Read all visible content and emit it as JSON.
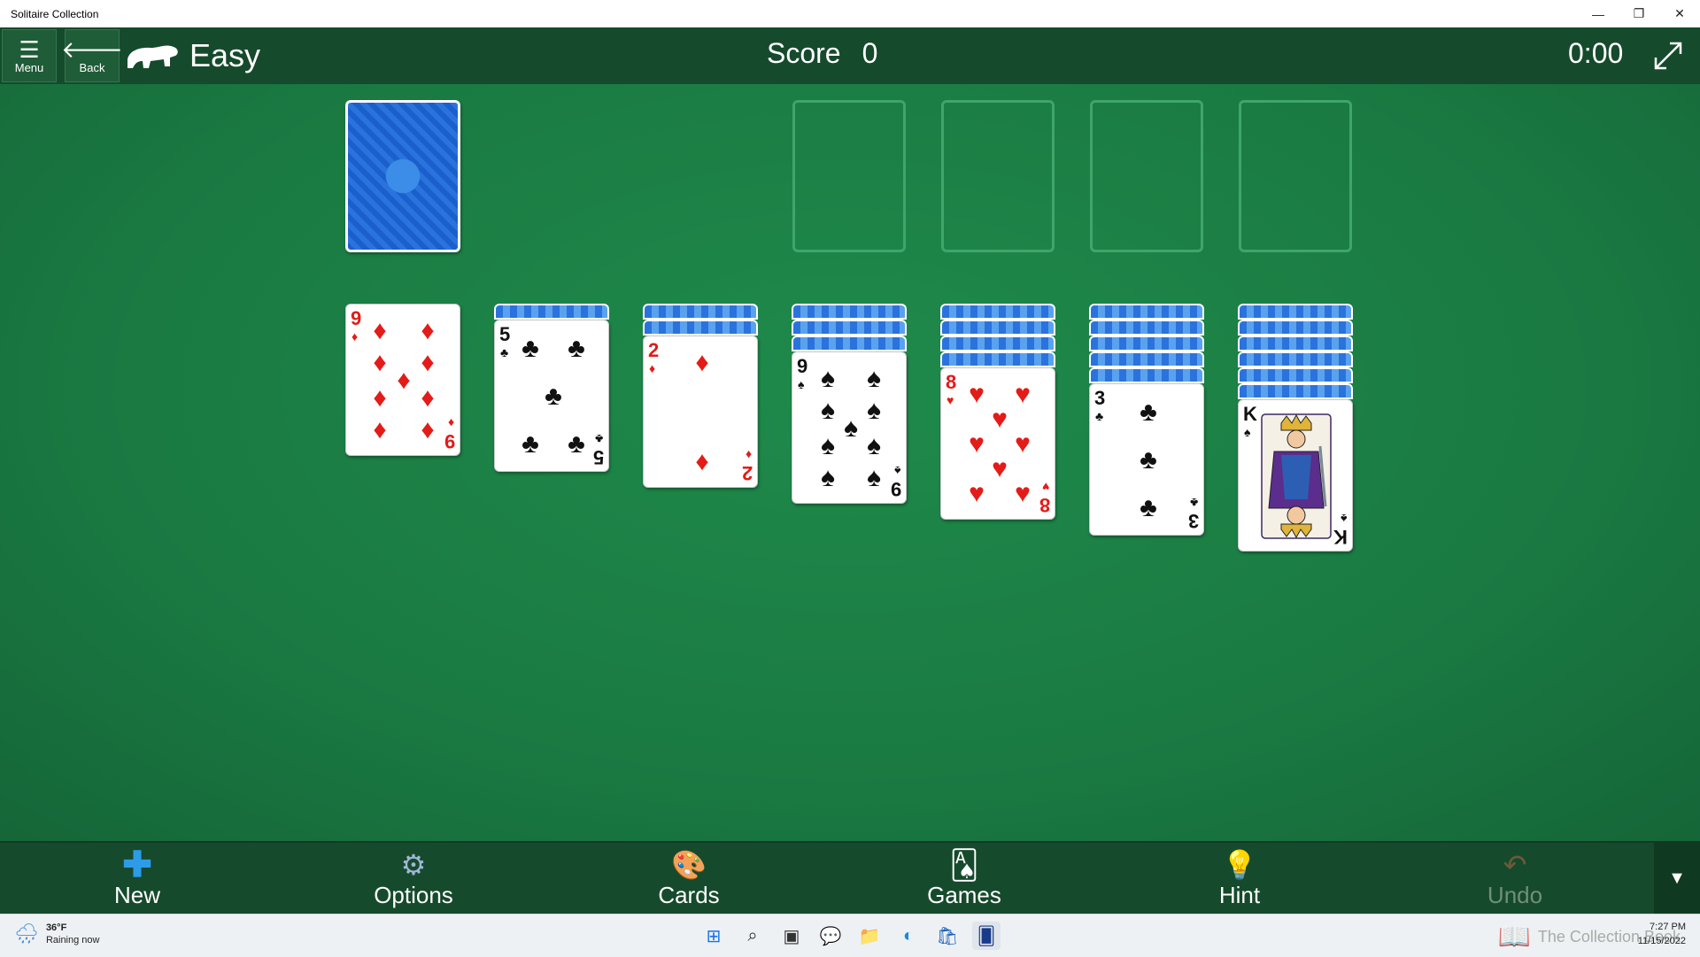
{
  "window": {
    "title": "Solitaire Collection",
    "controls": {
      "minimize": "—",
      "restore": "❐",
      "close": "✕"
    }
  },
  "header": {
    "menu_label": "Menu",
    "back_label": "Back",
    "difficulty": "Easy",
    "score_label": "Score",
    "score_value": "0",
    "timer": "0:00"
  },
  "board": {
    "tableau": [
      {
        "rank": "9",
        "suit": "♦",
        "color": "red"
      },
      {
        "rank": "5",
        "suit": "♣",
        "color": "black"
      },
      {
        "rank": "2",
        "suit": "♦",
        "color": "red"
      },
      {
        "rank": "9",
        "suit": "♠",
        "color": "black"
      },
      {
        "rank": "8",
        "suit": "♥",
        "color": "red"
      },
      {
        "rank": "3",
        "suit": "♣",
        "color": "black"
      },
      {
        "rank": "K",
        "suit": "♠",
        "color": "black"
      }
    ]
  },
  "appbar": {
    "new_label": "New",
    "options_label": "Options",
    "cards_label": "Cards",
    "games_label": "Games",
    "hint_label": "Hint",
    "undo_label": "Undo"
  },
  "taskbar": {
    "weather_temp": "36°F",
    "weather_desc": "Raining now",
    "time": "7:27 PM",
    "date": "11/15/2022",
    "watermark": "The Collection Book"
  },
  "colors": {
    "felt": "#1e7a45",
    "header": "#164a2c",
    "red_suit": "#e41b17",
    "card_back": "#1553b8"
  }
}
